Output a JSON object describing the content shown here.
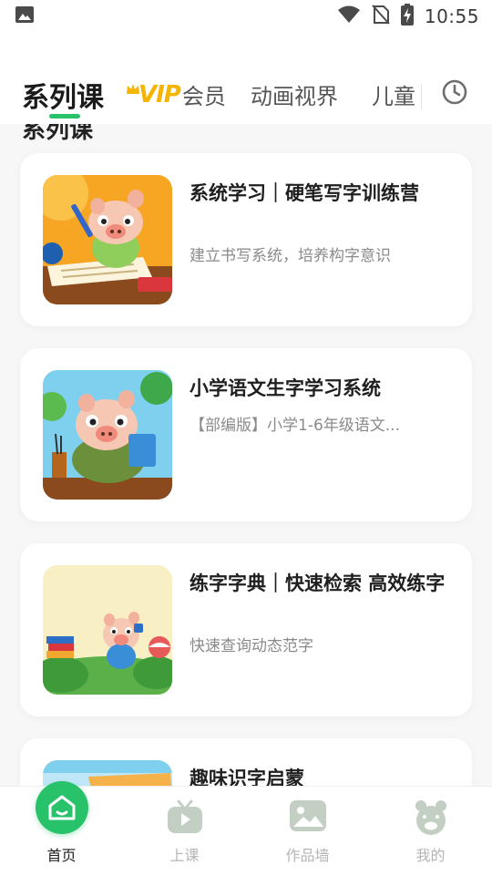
{
  "status_bar": {
    "time": "10:55",
    "icons": [
      "image-icon",
      "wifi-icon",
      "no-sim-icon",
      "battery-charging-icon"
    ]
  },
  "tabs": {
    "active": "系列课",
    "vip_logo": "VIP",
    "vip": "会员",
    "animation": "动画视界",
    "kids": "儿童",
    "history_icon": "clock-icon"
  },
  "list": {
    "peek_title": "系列课",
    "cards": [
      {
        "title": "系统学习｜硬笔写字训练营",
        "subtitle": "建立书写系统，培养构字意识"
      },
      {
        "title": "小学语文生字学习系统",
        "subtitle": "【部编版】小学1-6年级语文..."
      },
      {
        "title": "练字字典｜快速检索 高效练字",
        "subtitle": "快速查询动态范字"
      },
      {
        "title": "趣味识字启蒙",
        "subtitle": ""
      }
    ]
  },
  "bottom_nav": {
    "items": [
      {
        "label": "首页",
        "icon": "home-icon",
        "active": true
      },
      {
        "label": "上课",
        "icon": "tv-play-icon",
        "active": false
      },
      {
        "label": "作品墙",
        "icon": "picture-icon",
        "active": false
      },
      {
        "label": "我的",
        "icon": "pig-face-icon",
        "active": false
      }
    ]
  },
  "colors": {
    "accent": "#27c26a",
    "vip_gold": "#f5b400",
    "inactive": "#b5b5b5",
    "background": "#f6f7f6"
  }
}
